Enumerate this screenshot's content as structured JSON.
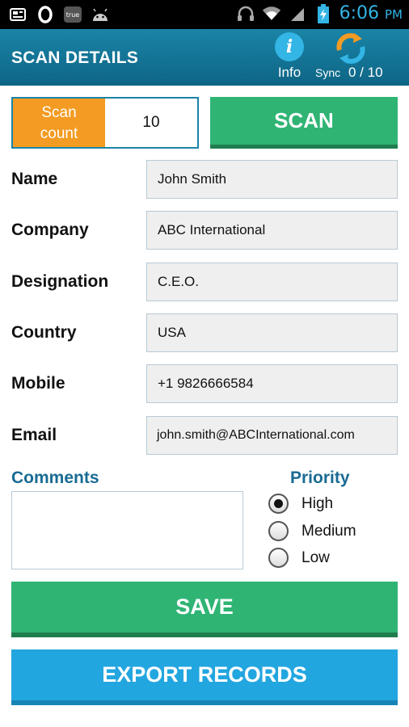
{
  "status_bar": {
    "time": "6:06",
    "ampm": "PM",
    "accent": "#33b5e5",
    "true_badge": "true"
  },
  "header": {
    "title": "SCAN DETAILS",
    "info_label": "Info",
    "sync_label": "Sync",
    "sync_count": "0 / 10"
  },
  "scan": {
    "count_label_line1": "Scan",
    "count_label_line2": "count",
    "count_value": "10",
    "button_label": "SCAN"
  },
  "form": {
    "name_label": "Name",
    "name_value": "John Smith",
    "company_label": "Company",
    "company_value": "ABC International",
    "designation_label": "Designation",
    "designation_value": "C.E.O.",
    "country_label": "Country",
    "country_value": "USA",
    "mobile_label": "Mobile",
    "mobile_value": "+1 9826666584",
    "email_label": "Email",
    "email_value": "john.smith@ABCInternational.com"
  },
  "comments": {
    "label": "Comments",
    "value": ""
  },
  "priority": {
    "label": "Priority",
    "options": [
      "High",
      "Medium",
      "Low"
    ],
    "selected": "High"
  },
  "actions": {
    "save_label": "SAVE",
    "export_label": "EXPORT RECORDS"
  },
  "colors": {
    "header": "#1a84a7",
    "scan_count": "#f39b22",
    "green": "#2fb474",
    "blue": "#22a6e0",
    "section_text": "#1a6b94"
  }
}
